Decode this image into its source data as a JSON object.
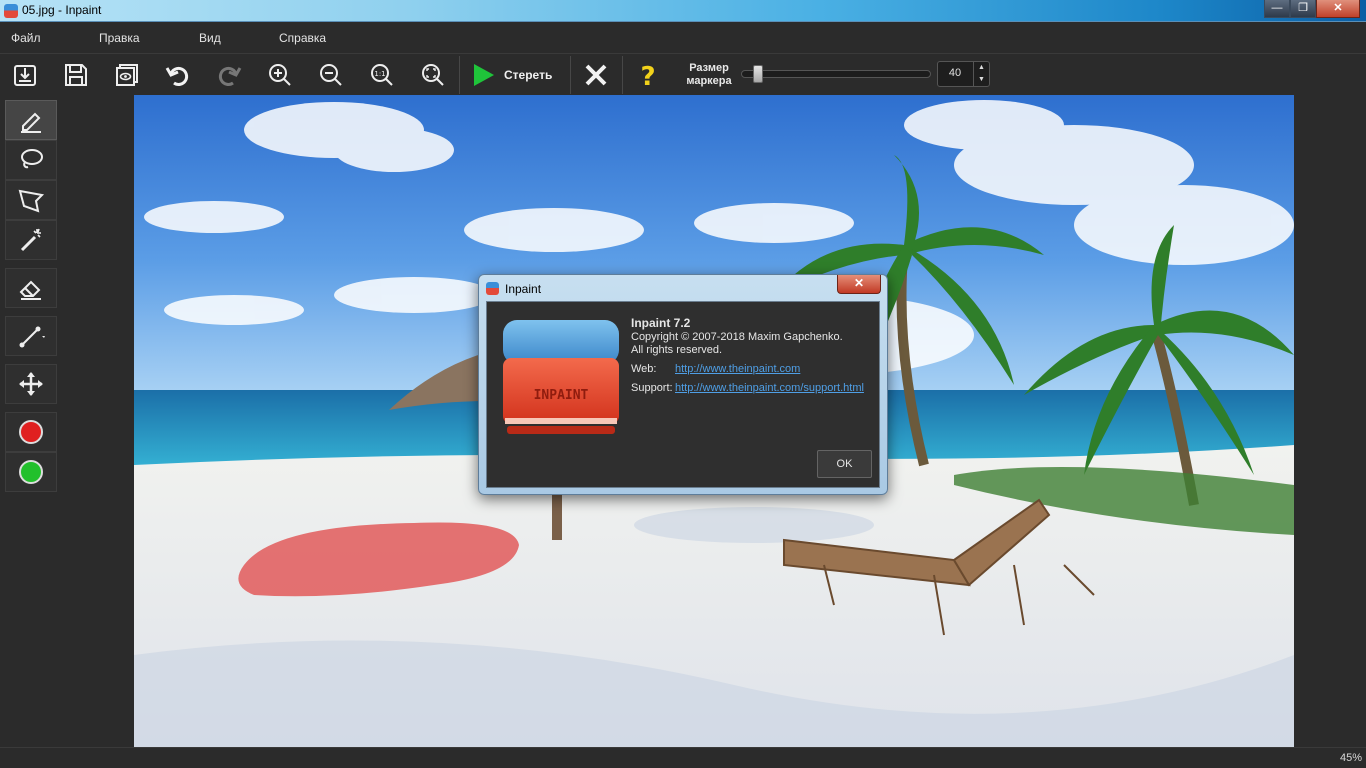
{
  "window": {
    "title": "05.jpg - Inpaint",
    "minimize": "—",
    "maximize": "❐",
    "close": "✕"
  },
  "menu": {
    "items": [
      "Файл",
      "Правка",
      "Вид",
      "Справка"
    ]
  },
  "toolbar": {
    "erase_label": "Стереть",
    "marker_size_label_1": "Размер",
    "marker_size_label_2": "маркера",
    "marker_size_value": "40",
    "marker_size_slider_fraction": 0.06
  },
  "status": {
    "zoom": "45%"
  },
  "dialog": {
    "title": "Inpaint",
    "close": "✕",
    "logo_text": "INPAINT",
    "product": "Inpaint 7.2",
    "copyright": "Copyright © 2007-2018 Maxim Gapchenko.",
    "rights": "All rights reserved.",
    "web_label": "Web:",
    "web_url": "http://www.theinpaint.com",
    "support_label": "Support:",
    "support_url": "http://www.theinpaint.com/support.html",
    "ok": "OK"
  },
  "colors": {
    "accent_red": "#e02020",
    "accent_green": "#22c02c",
    "play_green": "#1fc43a",
    "help_yellow": "#f2d21b"
  }
}
